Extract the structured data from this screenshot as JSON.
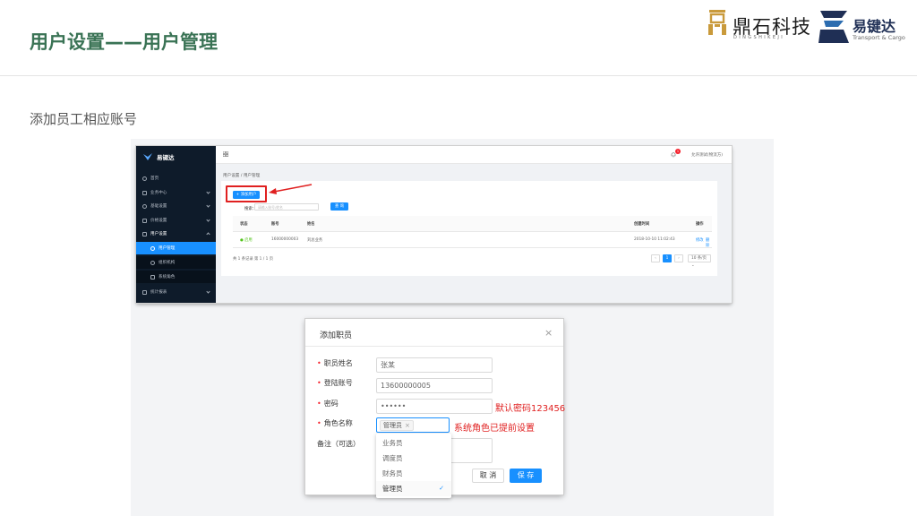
{
  "slide": {
    "title": "用户设置——用户管理",
    "subtitle": "添加员工相应账号"
  },
  "logos": {
    "dingshi_name": "鼎石科技",
    "dingshi_pinyin": "DINGSHIKEJI",
    "yjd_name": "易键达",
    "yjd_sub": "Transport & Cargo"
  },
  "app": {
    "brand": "易键达",
    "sidebar": [
      {
        "label": "首页"
      },
      {
        "label": "业务中心"
      },
      {
        "label": "基础设置"
      },
      {
        "label": "价格设置"
      },
      {
        "label": "用户设置"
      },
      {
        "label": "用户管理"
      },
      {
        "label": "组织机构"
      },
      {
        "label": "系统角色"
      },
      {
        "label": "统计报表"
      }
    ],
    "topbar": {
      "badge": "1",
      "user": "允许测试(物流方)"
    },
    "breadcrumb": "用户设置 / 用户管理",
    "add_button": "+ 添加用户",
    "search": {
      "label": "搜索：",
      "placeholder": "请输入账号/姓名",
      "button": "查 询"
    },
    "table": {
      "headers": [
        "状态",
        "账号",
        "姓名",
        "创建时间",
        "操作"
      ],
      "rows": [
        {
          "status": "● 启用",
          "account": "16000000003",
          "name": "刘总业务",
          "created": "2018-10-10 11:02:43",
          "edit": "修改",
          "delete": "删除"
        }
      ]
    },
    "pager": {
      "summary": "共 1 条记录 第 1 / 1 页",
      "prev": "‹",
      "current": "1",
      "next": "›",
      "size": "10 条/页 ⌄"
    }
  },
  "dialog": {
    "title": "添加职员",
    "close": "×",
    "fields": {
      "name_label": "职员姓名",
      "name_value": "张某",
      "account_label": "登陆账号",
      "account_value": "13600000005",
      "password_label": "密码",
      "password_value": "••••••",
      "role_label": "角色名称",
      "role_tag": "管理员",
      "role_tag_close": "×",
      "remark_label": "备注（可选）"
    },
    "cancel": "取 消",
    "save": "保 存",
    "dropdown": [
      {
        "label": "业务员",
        "selected": false
      },
      {
        "label": "调度员",
        "selected": false
      },
      {
        "label": "财务员",
        "selected": false
      },
      {
        "label": "管理员",
        "selected": true
      }
    ],
    "check_mark": "✓"
  },
  "annotations": {
    "password_note": "默认密码123456",
    "role_note": "系统角色已提前设置"
  },
  "colors": {
    "title_green": "#3a7355",
    "primary_blue": "#1890ff",
    "annotation_red": "#e02020",
    "sidebar_dark": "#0e1b2a"
  }
}
